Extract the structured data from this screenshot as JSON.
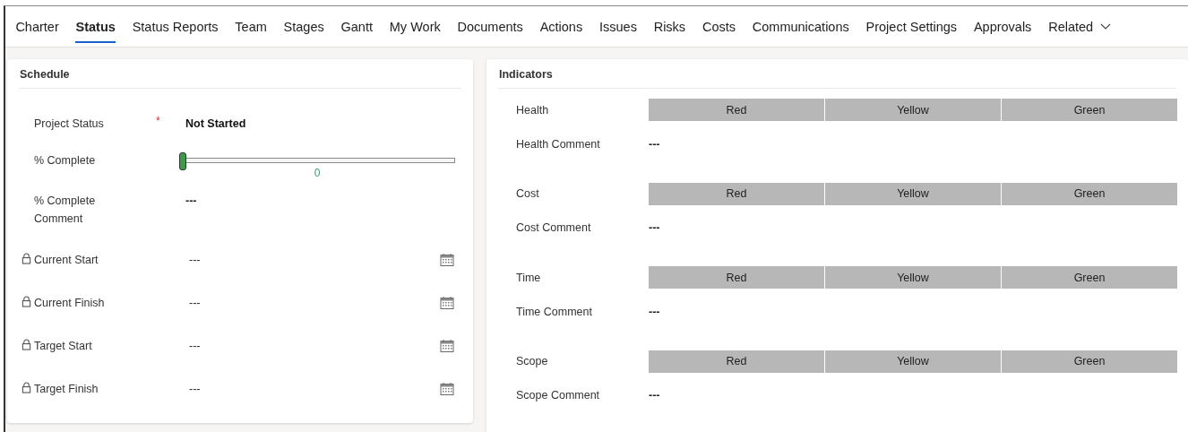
{
  "tabs": [
    {
      "label": "Charter",
      "selected": false
    },
    {
      "label": "Status",
      "selected": true
    },
    {
      "label": "Status Reports",
      "selected": false
    },
    {
      "label": "Team",
      "selected": false
    },
    {
      "label": "Stages",
      "selected": false
    },
    {
      "label": "Gantt",
      "selected": false
    },
    {
      "label": "My Work",
      "selected": false
    },
    {
      "label": "Documents",
      "selected": false
    },
    {
      "label": "Actions",
      "selected": false
    },
    {
      "label": "Issues",
      "selected": false
    },
    {
      "label": "Risks",
      "selected": false
    },
    {
      "label": "Costs",
      "selected": false
    },
    {
      "label": "Communications",
      "selected": false
    },
    {
      "label": "Project Settings",
      "selected": false
    },
    {
      "label": "Approvals",
      "selected": false
    },
    {
      "label": "Related",
      "selected": false,
      "kind": "dropdown"
    }
  ],
  "schedule": {
    "title": "Schedule",
    "fields": [
      {
        "kind": "choice",
        "label": "Project Status",
        "required_mark": "*",
        "value": "Not Started"
      },
      {
        "kind": "slider",
        "label": "% Complete",
        "level": 0,
        "reading": "0"
      },
      {
        "kind": "text",
        "label": "% Complete Comment",
        "value": "---"
      },
      {
        "kind": "date",
        "label": "Current Start",
        "locked": true,
        "value": "---"
      },
      {
        "kind": "date",
        "label": "Current Finish",
        "locked": true,
        "value": "---"
      },
      {
        "kind": "date",
        "label": "Target Start",
        "locked": true,
        "value": "---"
      },
      {
        "kind": "date",
        "label": "Target Finish",
        "locked": true,
        "value": "---"
      }
    ]
  },
  "indicators": {
    "title": "Indicators",
    "groups": [
      {
        "label": "Health",
        "options": [
          {
            "label": "Red",
            "selected": false
          },
          {
            "label": "Yellow",
            "selected": false
          },
          {
            "label": "Green",
            "selected": false
          }
        ],
        "comment_label": "Health Comment",
        "comment": "---"
      },
      {
        "label": "Cost",
        "options": [
          {
            "label": "Red",
            "selected": false
          },
          {
            "label": "Yellow",
            "selected": false
          },
          {
            "label": "Green",
            "selected": false
          }
        ],
        "comment_label": "Cost Comment",
        "comment": "---"
      },
      {
        "label": "Time",
        "options": [
          {
            "label": "Red",
            "selected": false
          },
          {
            "label": "Yellow",
            "selected": false
          },
          {
            "label": "Green",
            "selected": false
          }
        ],
        "comment_label": "Time Comment",
        "comment": "---"
      },
      {
        "label": "Scope",
        "options": [
          {
            "label": "Red",
            "selected": false
          },
          {
            "label": "Yellow",
            "selected": false
          },
          {
            "label": "Green",
            "selected": false
          }
        ],
        "comment_label": "Scope Comment",
        "comment": "---"
      }
    ]
  }
}
